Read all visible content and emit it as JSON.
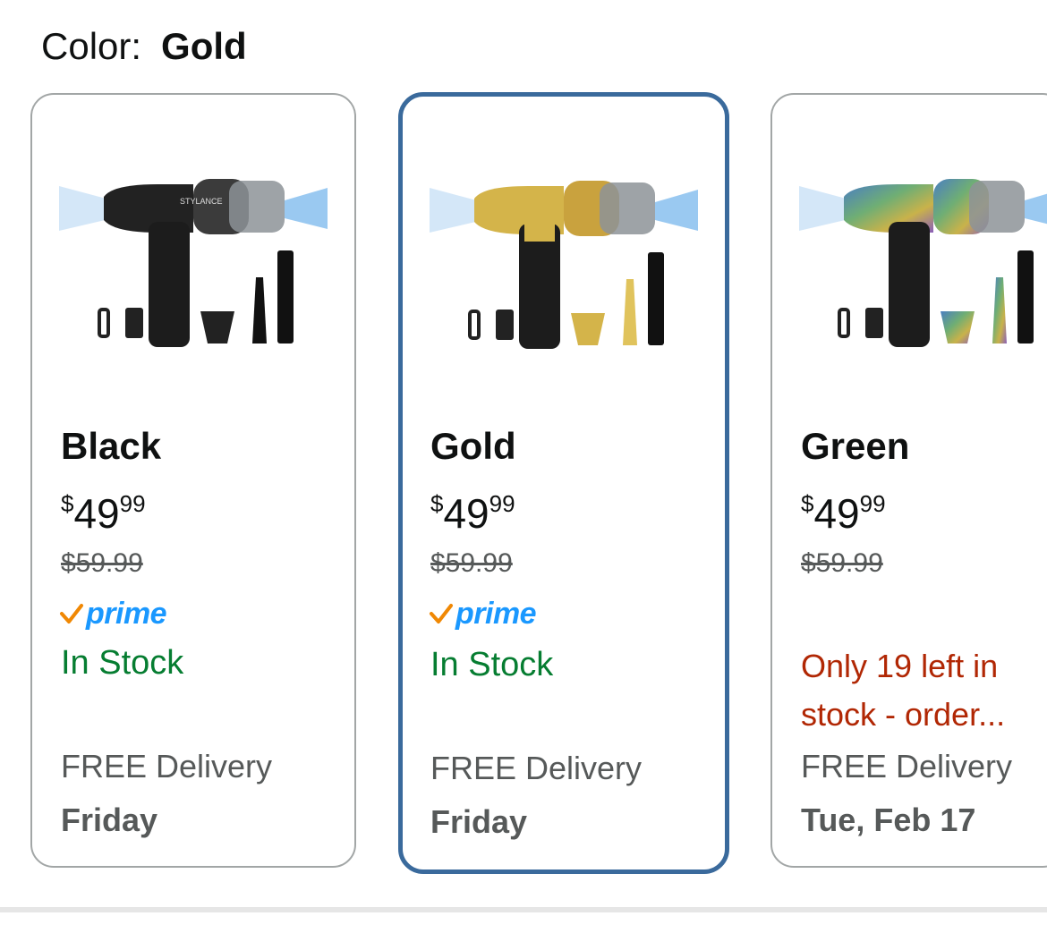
{
  "color_selector": {
    "label": "Color:",
    "selected": "Gold"
  },
  "options": [
    {
      "name": "Black",
      "price_symbol": "$",
      "price_whole": "49",
      "price_fraction": "99",
      "list_price": "$59.99",
      "prime_label": "prime",
      "availability": "In Stock",
      "delivery_label": "FREE Delivery",
      "delivery_day": "Friday",
      "body_color": "#1c1c1c",
      "accent_color": "#2a2a2a"
    },
    {
      "name": "Gold",
      "price_symbol": "$",
      "price_whole": "49",
      "price_fraction": "99",
      "list_price": "$59.99",
      "prime_label": "prime",
      "availability": "In Stock",
      "delivery_label": "FREE Delivery",
      "delivery_day": "Friday",
      "body_color": "#1c1c1c",
      "accent_color": "#d4b44a"
    },
    {
      "name": "Green",
      "price_symbol": "$",
      "price_whole": "49",
      "price_fraction": "99",
      "list_price": "$59.99",
      "availability": "Only 19 left in stock - order...",
      "delivery_label": "FREE Delivery",
      "delivery_day": "Tue, Feb 17",
      "body_color": "#1c1c1c",
      "accent_color": "#5a8a6a"
    }
  ],
  "colors": {
    "selected_border": "#3a6a9c",
    "prime_blue": "#1a98ff",
    "prime_check": "#f08804",
    "in_stock_green": "#067d31",
    "low_stock_red": "#b12704"
  },
  "icons": {
    "prime_check": "check-mark-icon",
    "air_flow": "air-stream-icon"
  }
}
